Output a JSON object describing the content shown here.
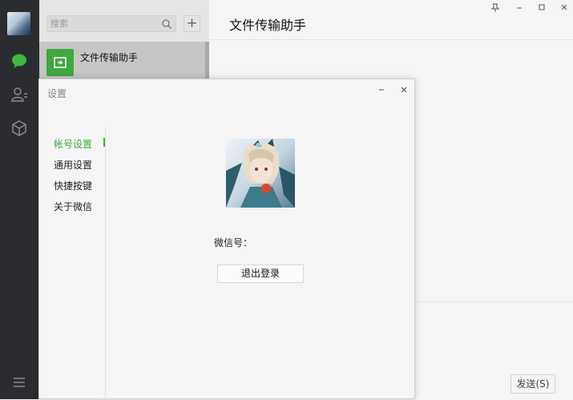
{
  "search": {
    "placeholder": "搜索"
  },
  "list": {
    "add_label": "+",
    "chats": [
      {
        "name": "文件传输助手"
      }
    ]
  },
  "main": {
    "title": "文件传输助手",
    "send_label": "发送(S)"
  },
  "settings": {
    "title": "设置",
    "nav": [
      {
        "label": "帐号设置",
        "active": true
      },
      {
        "label": "通用设置"
      },
      {
        "label": "快捷按键"
      },
      {
        "label": "关于微信"
      }
    ],
    "wechat_id_label": "微信号：",
    "logout_label": "退出登录"
  },
  "colors": {
    "accent": "#3fa93f",
    "rail": "#2b2c2f",
    "list_bg": "#e6e5e5",
    "selected_chat": "#c6c6c6"
  }
}
